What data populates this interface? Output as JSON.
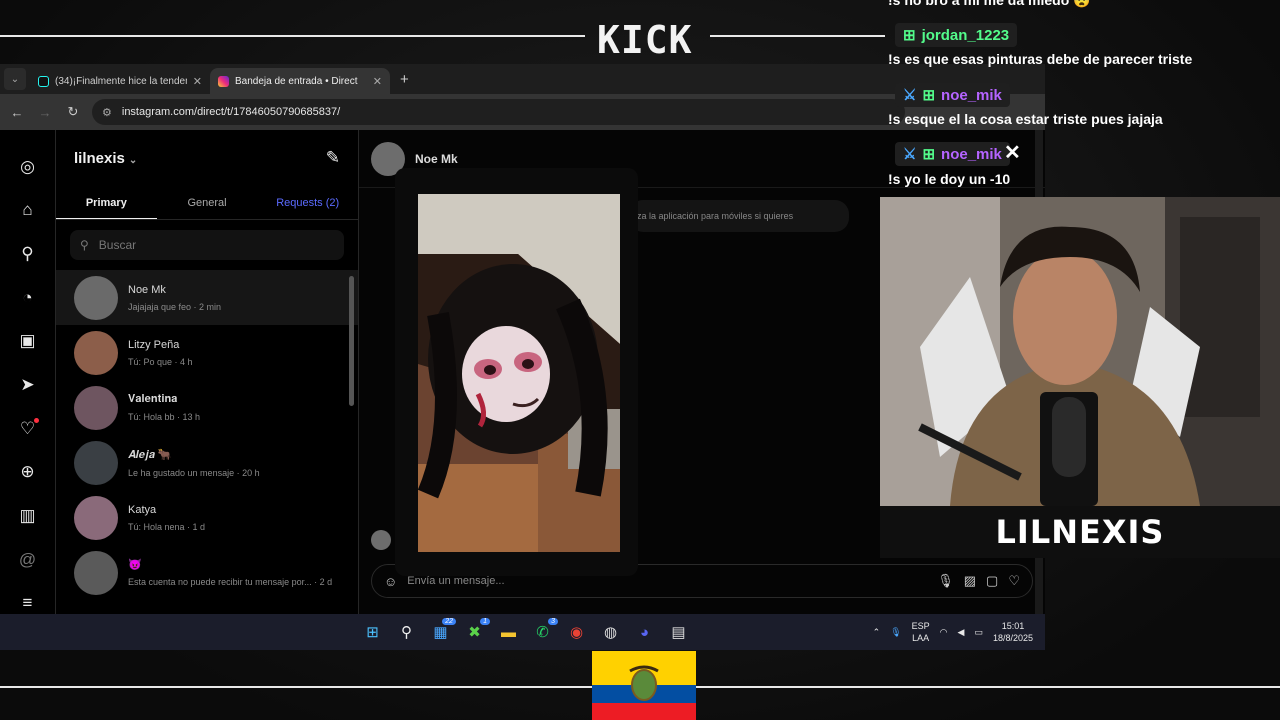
{
  "stream": {
    "platform_logo": "KICK",
    "streamer_name": "LILNEXIS"
  },
  "browser": {
    "tabs": [
      {
        "title": "(34)¡Finalmente hice la tendenc",
        "icon": "tiktok-icon"
      },
      {
        "title": "Bandeja de entrada • Direct",
        "icon": "instagram-icon"
      }
    ],
    "new_tab": "+",
    "url": "instagram.com/direct/t/17846050790685837/"
  },
  "instagram": {
    "username": "lilnexis",
    "tabs": {
      "primary": "Primary",
      "general": "General",
      "requests": "Requests (2)"
    },
    "search_placeholder": "Buscar",
    "conversations": [
      {
        "name": "Noe Mk",
        "preview": "Jajajaja que feo · 2 min",
        "avatar_color": "#6a6a6a"
      },
      {
        "name": "Litzy Peña",
        "preview": "Tú: Po que · 4 h",
        "avatar_color": "#8c5e4a"
      },
      {
        "name": "𝐕𝐚𝐥𝐞𝐧𝐭𝐢𝐧𝐚",
        "preview": "Tú: Hola bb · 13 h",
        "avatar_color": "#6e5560"
      },
      {
        "name": "𝑨𝒍𝒆𝒋𝒂 🐂",
        "preview": "Le ha gustado un mensaje · 20 h",
        "avatar_color": "#3a3f44"
      },
      {
        "name": "Katya",
        "preview": "Tú: Hola nena · 1 d",
        "avatar_color": "#8a6a7a"
      },
      {
        "name": "😈",
        "preview": "Esta cuenta no puede recibir tu mensaje por... · 2 d",
        "avatar_color": "#5a5a5a"
      }
    ],
    "chat": {
      "name": "Noe Mk",
      "note": "za la aplicación para móviles si quieres",
      "input_placeholder": "Envía un mensaje..."
    }
  },
  "taskbar": {
    "badges": {
      "widgets": "22",
      "xbox": "1",
      "whatsapp": "3"
    },
    "language": {
      "line1": "ESP",
      "line2": "LAA"
    },
    "time": "15:01",
    "date": "18/8/2025"
  },
  "chat_overlay": {
    "messages": [
      {
        "text": "!s no bro a mi me da miedo 😨"
      },
      {
        "user": "jordan_1223",
        "user_color": "#53fc8b",
        "text": "!s es que esas pinturas debe de parecer triste"
      },
      {
        "user": "noe_mik",
        "user_color": "#b564ff",
        "text": "!s esque el la cosa estar triste pues jajaja"
      },
      {
        "user": "noe_mik",
        "user_color": "#b564ff",
        "text": "!s yo le doy un -10"
      }
    ]
  }
}
